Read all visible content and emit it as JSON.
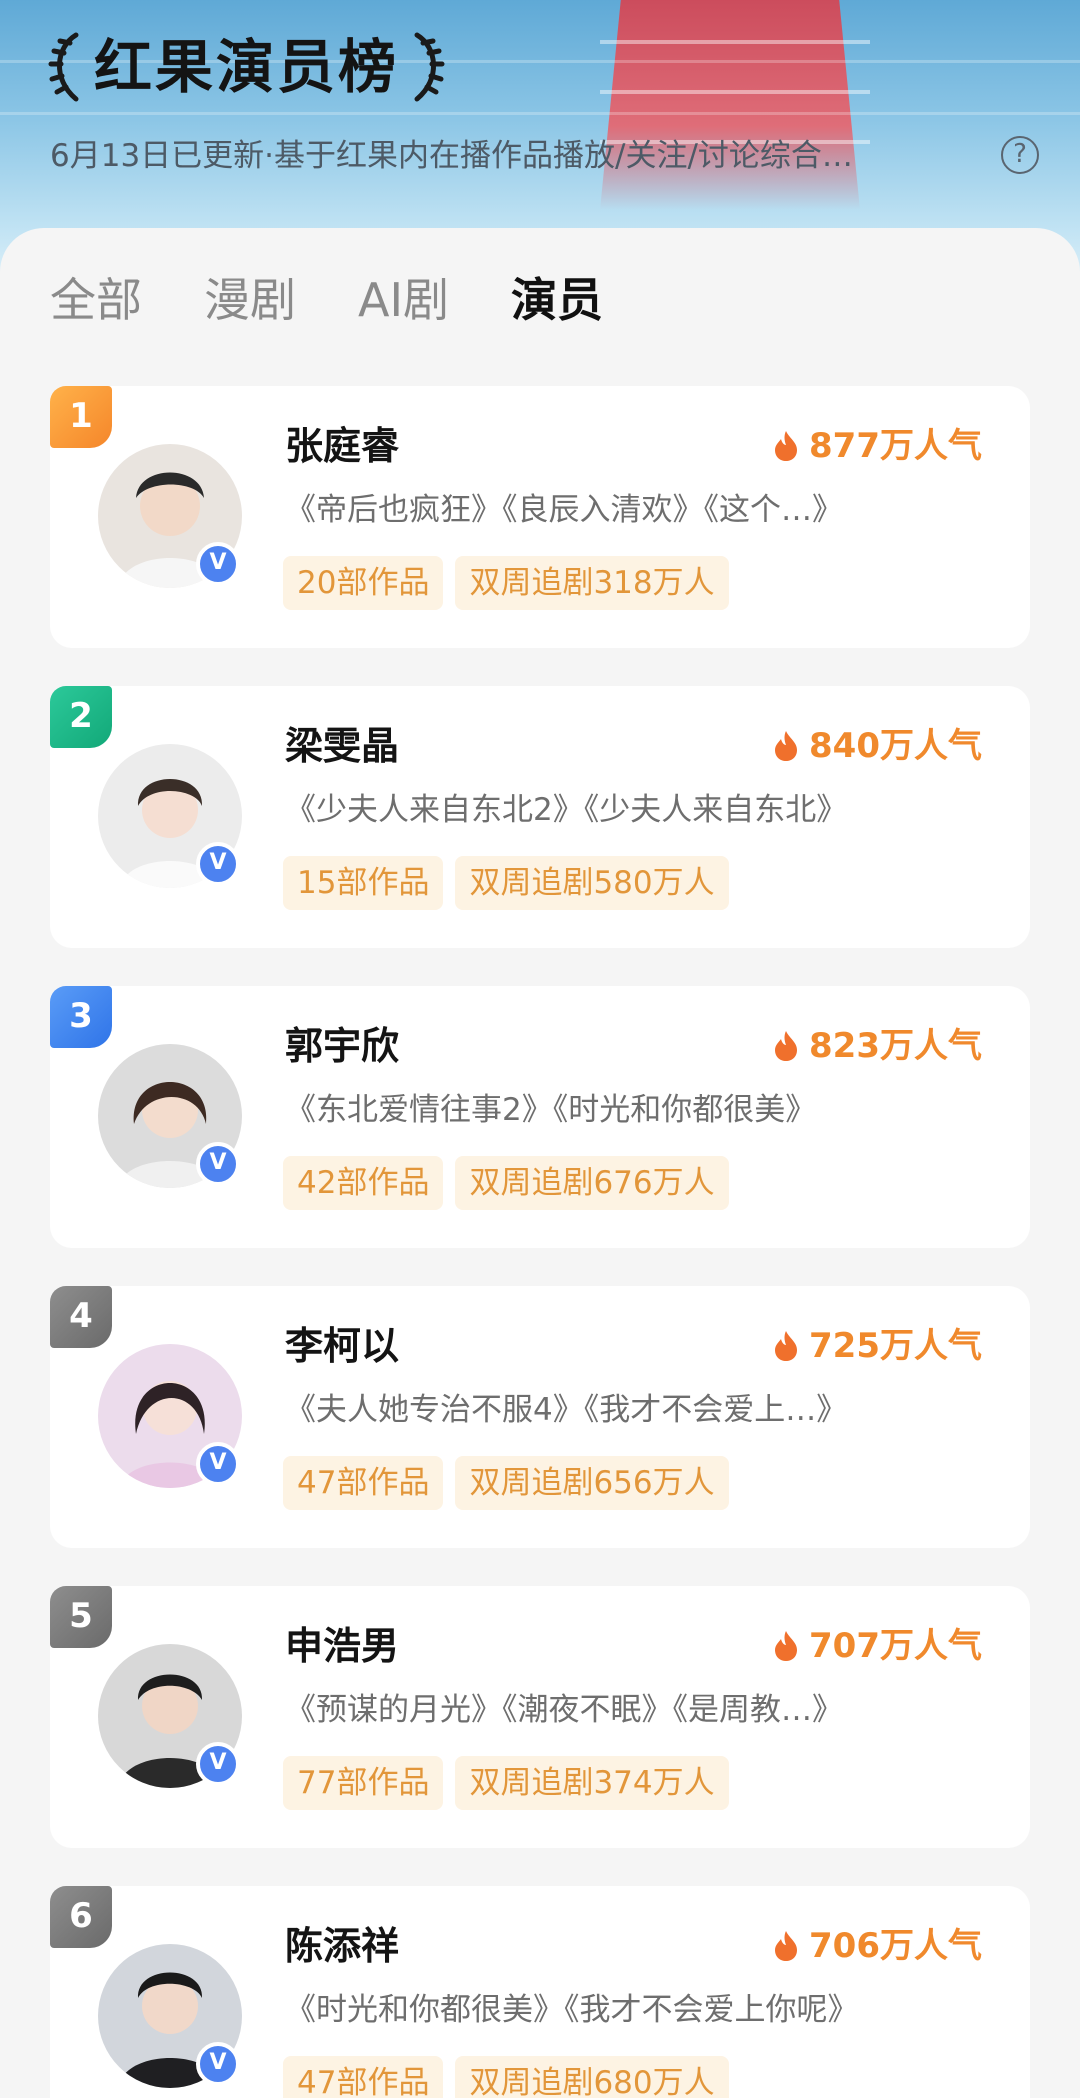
{
  "header": {
    "title": "红果演员榜",
    "subtitle": "6月13日已更新·基于红果内在播作品播放/关注/讨论综合…",
    "help_icon": "?"
  },
  "tabs": [
    {
      "label": "全部",
      "active": false
    },
    {
      "label": "漫剧",
      "active": false
    },
    {
      "label": "AI剧",
      "active": false
    },
    {
      "label": "演员",
      "active": true
    }
  ],
  "colors": {
    "rank_1": "#f5962d",
    "rank_2": "#1fb98a",
    "rank_3": "#3a82f0",
    "rank_other": "#7b7b7b",
    "popularity": "#f0892c",
    "verified": "#4d82f0"
  },
  "verified_badge": "V",
  "actors": [
    {
      "rank": "1",
      "name": "张庭睿",
      "popularity": "877万人气",
      "works": "《帝后也疯狂》《良辰入清欢》《这个…》",
      "works_count": "20部作品",
      "followers": "双周追剧318万人"
    },
    {
      "rank": "2",
      "name": "梁雯晶",
      "popularity": "840万人气",
      "works": "《少夫人来自东北2》《少夫人来自东北》",
      "works_count": "15部作品",
      "followers": "双周追剧580万人"
    },
    {
      "rank": "3",
      "name": "郭宇欣",
      "popularity": "823万人气",
      "works": "《东北爱情往事2》《时光和你都很美》",
      "works_count": "42部作品",
      "followers": "双周追剧676万人"
    },
    {
      "rank": "4",
      "name": "李柯以",
      "popularity": "725万人气",
      "works": "《夫人她专治不服4》《我才不会爱上…》",
      "works_count": "47部作品",
      "followers": "双周追剧656万人"
    },
    {
      "rank": "5",
      "name": "申浩男",
      "popularity": "707万人气",
      "works": "《预谋的月光》《潮夜不眠》《是周教…》",
      "works_count": "77部作品",
      "followers": "双周追剧374万人"
    },
    {
      "rank": "6",
      "name": "陈添祥",
      "popularity": "706万人气",
      "works": "《时光和你都很美》《我才不会爱上你呢》",
      "works_count": "47部作品",
      "followers": "双周追剧680万人"
    }
  ]
}
